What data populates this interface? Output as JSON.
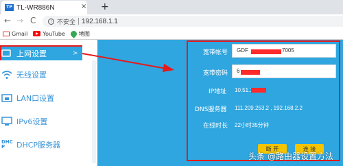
{
  "browser": {
    "tab_title": "TL-WR886N",
    "tab_favicon_text": "TP",
    "tab_close": "×",
    "new_tab": "+",
    "back": "←",
    "forward": "→",
    "reload": "C",
    "insecure_label": "不安全",
    "url": "192.168.1.1"
  },
  "bookmarks": [
    {
      "label": "Gmail",
      "icon": "gmail-icon"
    },
    {
      "label": "YouTube",
      "icon": "youtube-icon"
    },
    {
      "label": "地图",
      "icon": "maps-icon"
    }
  ],
  "sidebar": {
    "items": [
      {
        "label": "上网设置",
        "icon": "globe-icon",
        "active": true,
        "chevron": ">"
      },
      {
        "label": "无线设置",
        "icon": "wifi-icon"
      },
      {
        "label": "LAN口设置",
        "icon": "lan-port-icon"
      },
      {
        "label": "IPv6设置",
        "icon": "monitor-icon"
      },
      {
        "label": "DHCP服务器",
        "icon": "dhcp-icon"
      }
    ],
    "icon_dhcp_text": "DHCP"
  },
  "form": {
    "account_label": "宽带帐号",
    "account_value": "GDF",
    "account_value_suffix": "7005",
    "password_label": "宽带密码",
    "password_value": "6",
    "ip_label": "IP地址",
    "ip_value": "10.51.1",
    "dns_label": "DNS服务器",
    "dns_value": "111.209.253.2 , 192.168.2.2",
    "uptime_label": "在线时长",
    "uptime_value": "22小时35分钟",
    "disconnect_button": "断 开",
    "connect_button": "连 接"
  },
  "watermark": {
    "platform": "头条",
    "account": "@路由器设置方法"
  },
  "colors": {
    "accent_blue": "#2fa6df",
    "highlight_red": "#e8191a",
    "button_yellow": "#f4c400"
  }
}
